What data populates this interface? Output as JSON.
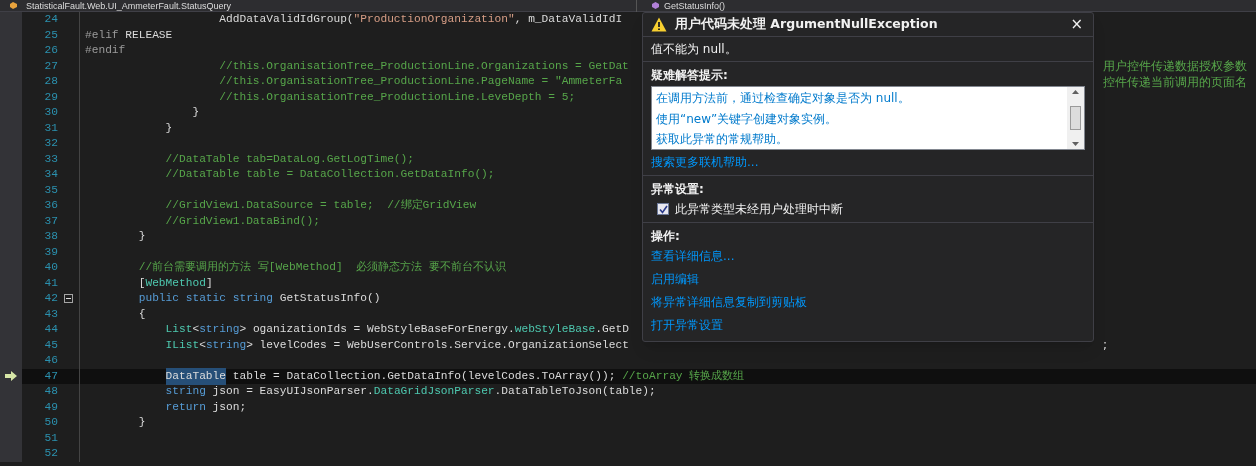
{
  "breadcrumb": {
    "class_path": "StatisticalFault.Web.UI_AmmeterFault.StatusQuery",
    "member": "GetStatusInfo()"
  },
  "lines": [
    {
      "number": "24",
      "current": false,
      "fold": false,
      "segments": [
        {
          "kind": "plain",
          "text": "                    AddDataValidIdGroup("
        },
        {
          "kind": "string",
          "text": "\"ProductionOrganization\""
        },
        {
          "kind": "plain",
          "text": ", m_DataValidIdI"
        }
      ]
    },
    {
      "number": "25",
      "current": false,
      "fold": false,
      "segments": [
        {
          "kind": "preproc",
          "text": "#elif"
        },
        {
          "kind": "plain",
          "text": " RELEASE"
        }
      ]
    },
    {
      "number": "26",
      "current": false,
      "fold": false,
      "segments": [
        {
          "kind": "preproc",
          "text": "#endif"
        }
      ]
    },
    {
      "number": "27",
      "current": false,
      "fold": false,
      "segments": [
        {
          "kind": "comment",
          "text": "                    //this.OrganisationTree_ProductionLine.Organizations = GetDat"
        }
      ],
      "tail": [
        {
          "kind": "comment",
          "text": "用户控件传递数据授权参数"
        }
      ]
    },
    {
      "number": "28",
      "current": false,
      "fold": false,
      "segments": [
        {
          "kind": "comment",
          "text": "                    //this.OrganisationTree_ProductionLine.PageName = \"AmmeterFa"
        }
      ],
      "tail": [
        {
          "kind": "comment",
          "text": "控件传递当前调用的页面名"
        }
      ]
    },
    {
      "number": "29",
      "current": false,
      "fold": false,
      "segments": [
        {
          "kind": "comment",
          "text": "                    //this.OrganisationTree_ProductionLine.LeveDepth = 5;"
        }
      ]
    },
    {
      "number": "30",
      "current": false,
      "fold": false,
      "segments": [
        {
          "kind": "plain",
          "text": "                }"
        }
      ]
    },
    {
      "number": "31",
      "current": false,
      "fold": false,
      "segments": [
        {
          "kind": "plain",
          "text": "            }"
        }
      ]
    },
    {
      "number": "32",
      "current": false,
      "fold": false
    },
    {
      "number": "33",
      "current": false,
      "fold": false,
      "segments": [
        {
          "kind": "comment",
          "text": "            //DataTable tab=DataLog.GetLogTime();"
        }
      ]
    },
    {
      "number": "34",
      "current": false,
      "fold": false,
      "segments": [
        {
          "kind": "comment",
          "text": "            //DataTable table = DataCollection.GetDataInfo();"
        }
      ]
    },
    {
      "number": "35",
      "current": false,
      "fold": false
    },
    {
      "number": "36",
      "current": false,
      "fold": false,
      "segments": [
        {
          "kind": "comment",
          "text": "            //GridView1.DataSource = table;  //绑定GridView"
        }
      ]
    },
    {
      "number": "37",
      "current": false,
      "fold": false,
      "segments": [
        {
          "kind": "comment",
          "text": "            //GridView1.DataBind();"
        }
      ]
    },
    {
      "number": "38",
      "current": false,
      "fold": false,
      "segments": [
        {
          "kind": "plain",
          "text": "        }"
        }
      ]
    },
    {
      "number": "39",
      "current": false,
      "fold": false
    },
    {
      "number": "40",
      "current": false,
      "fold": false,
      "segments": [
        {
          "kind": "comment",
          "text": "        //前台需要调用的方法 写[WebMethod]  必须静态方法 要不前台不认识"
        }
      ]
    },
    {
      "number": "41",
      "current": false,
      "fold": false,
      "segments": [
        {
          "kind": "plain",
          "text": "        ["
        },
        {
          "kind": "type",
          "text": "WebMethod"
        },
        {
          "kind": "plain",
          "text": "]"
        }
      ]
    },
    {
      "number": "42",
      "current": false,
      "fold": true,
      "segments": [
        {
          "kind": "keyword",
          "text": "        public static string"
        },
        {
          "kind": "plain",
          "text": " GetStatusInfo()"
        }
      ]
    },
    {
      "number": "43",
      "current": false,
      "fold": false,
      "segments": [
        {
          "kind": "plain",
          "text": "        {"
        }
      ]
    },
    {
      "number": "44",
      "current": false,
      "fold": false,
      "segments": [
        {
          "kind": "type",
          "text": "            List"
        },
        {
          "kind": "plain",
          "text": "<"
        },
        {
          "kind": "keyword",
          "text": "string"
        },
        {
          "kind": "plain",
          "text": "> oganizationIds = WebStyleBaseForEnergy."
        },
        {
          "kind": "type",
          "text": "webStyleBase"
        },
        {
          "kind": "plain",
          "text": ".GetD"
        }
      ]
    },
    {
      "number": "45",
      "current": false,
      "fold": false,
      "segments": [
        {
          "kind": "type",
          "text": "            IList"
        },
        {
          "kind": "plain",
          "text": "<"
        },
        {
          "kind": "keyword",
          "text": "string"
        },
        {
          "kind": "plain",
          "text": "> levelCodes = WebUserControls.Service.OrganizationSelect"
        }
      ],
      "tail": [
        {
          "kind": "plain",
          "text": ";"
        }
      ]
    },
    {
      "number": "46",
      "current": false,
      "fold": false
    },
    {
      "number": "47",
      "current": true,
      "fold": false,
      "segments": [
        {
          "kind": "selected",
          "text": "            DataTable"
        },
        {
          "kind": "plain",
          "text": " table = DataCollection.GetDataInfo(levelCodes.ToArray());"
        },
        {
          "kind": "comment",
          "text": " //toArray 转换成数组"
        }
      ]
    },
    {
      "number": "48",
      "current": false,
      "fold": false,
      "segments": [
        {
          "kind": "keyword",
          "text": "            string"
        },
        {
          "kind": "plain",
          "text": " json = EasyUIJsonParser."
        },
        {
          "kind": "type",
          "text": "DataGridJsonParser"
        },
        {
          "kind": "plain",
          "text": ".DataTableToJson(table);"
        }
      ]
    },
    {
      "number": "49",
      "current": false,
      "fold": false,
      "segments": [
        {
          "kind": "keyword",
          "text": "            return"
        },
        {
          "kind": "plain",
          "text": " json;"
        }
      ]
    },
    {
      "number": "50",
      "current": false,
      "fold": false,
      "segments": [
        {
          "kind": "plain",
          "text": "        }"
        }
      ]
    },
    {
      "number": "51",
      "current": false,
      "fold": false
    },
    {
      "number": "52",
      "current": false,
      "fold": false
    }
  ],
  "exception_popup": {
    "title": "用户代码未处理 ArgumentNullException",
    "close": "×",
    "message": "值不能为 null。",
    "tips_heading": "疑难解答提示:",
    "tips": [
      "在调用方法前，通过检查确定对象是否为 null。",
      "使用“new”关键字创建对象实例。",
      "获取此异常的常规帮助。"
    ],
    "search_link": "搜索更多联机帮助...",
    "settings_heading": "异常设置:",
    "break_option": {
      "label": "此异常类型未经用户处理时中断",
      "checked": true
    },
    "actions_heading": "操作:",
    "actions": [
      "查看详细信息...",
      "启用编辑",
      "将异常详细信息复制到剪贴板",
      "打开异常设置"
    ]
  }
}
